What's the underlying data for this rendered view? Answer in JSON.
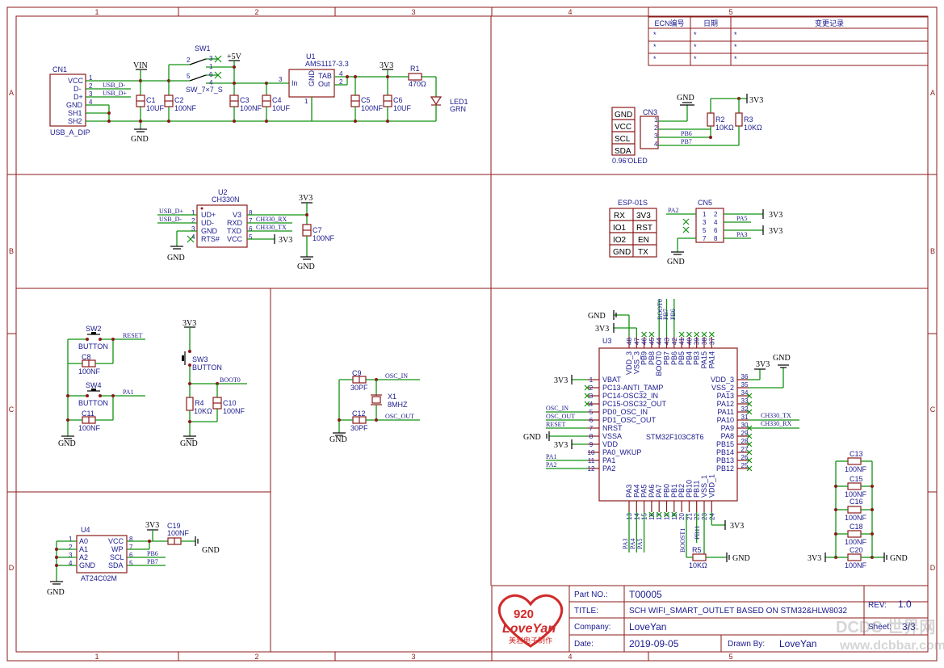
{
  "frame": {
    "columns": [
      "1",
      "2",
      "3",
      "4",
      "5"
    ],
    "rows": [
      "A",
      "B",
      "C",
      "D"
    ]
  },
  "ecn": {
    "headers": [
      "ECN编号",
      "日期",
      "变更记录"
    ],
    "rows": [
      [
        "*",
        "*",
        "*"
      ],
      [
        "*",
        "*",
        "*"
      ],
      [
        "*",
        "*",
        "*"
      ]
    ]
  },
  "usb": {
    "ref": "CN1",
    "name": "USB_A_DIP",
    "pins": [
      "VCC",
      "D-",
      "D+",
      "GND",
      "SH1",
      "SH2"
    ],
    "pin_nums": [
      "1",
      "2",
      "3",
      "4"
    ],
    "nets": [
      "USB_D-",
      "USB_D+"
    ]
  },
  "power": {
    "vin": "VIN",
    "v5": "+5V",
    "v3": "3V3",
    "gnd": "GND",
    "sw1_ref": "SW1",
    "sw1_name": "SW_7×7_S",
    "sw1_pins": [
      "2",
      "3",
      "1",
      "5",
      "6",
      "4"
    ],
    "u1_ref": "U1",
    "u1_name": "AMS1117-3.3",
    "u1_pins": [
      "In",
      "GND",
      "TAB",
      "Out"
    ],
    "u1_pin_nums": [
      "3",
      "1",
      "4",
      "2"
    ],
    "caps": [
      {
        "ref": "C1",
        "val": "10UF"
      },
      {
        "ref": "C2",
        "val": "100NF"
      },
      {
        "ref": "C3",
        "val": "100NF"
      },
      {
        "ref": "C4",
        "val": "10UF"
      },
      {
        "ref": "C5",
        "val": "100NF"
      },
      {
        "ref": "C6",
        "val": "10UF"
      }
    ],
    "r1_ref": "R1",
    "r1_val": "470Ω",
    "led_ref": "LED1",
    "led_val": "GRN"
  },
  "oled": {
    "labels": [
      "GND",
      "VCC",
      "SCL",
      "SDA"
    ],
    "name": "0.96'OLED",
    "cn_ref": "CN3",
    "pins": [
      "1",
      "2",
      "3",
      "4"
    ],
    "nets": [
      "PB6",
      "PB7"
    ],
    "r2_ref": "R2",
    "r2_val": "10KΩ",
    "r3_ref": "R3",
    "r3_val": "10KΩ"
  },
  "ch330": {
    "ref": "U2",
    "name": "CH330N",
    "left_pins": [
      "UD+",
      "UD-",
      "GND",
      "RTS#"
    ],
    "left_nums": [
      "1",
      "2",
      "3",
      "4"
    ],
    "right_pins": [
      "V3",
      "RXD",
      "TXD",
      "VCC"
    ],
    "right_nums": [
      "8",
      "7",
      "6",
      "5"
    ],
    "nets": [
      "USB_D+",
      "USB_D-",
      "CH330_RX",
      "CH330_TX"
    ],
    "c7_ref": "C7",
    "c7_val": "100NF"
  },
  "esp": {
    "title": "ESP-01S",
    "cells": [
      [
        "RX",
        "3V3"
      ],
      [
        "IO1",
        "RST"
      ],
      [
        "IO2",
        "EN"
      ],
      [
        "GND",
        "TX"
      ]
    ],
    "cn_ref": "CN5",
    "pins": [
      "1",
      "2",
      "3",
      "4",
      "5",
      "6",
      "7",
      "8"
    ],
    "nets": [
      "PA2",
      "PA5",
      "PA3"
    ]
  },
  "buttons": {
    "sw2_ref": "SW2",
    "sw2_name": "BUTTON",
    "sw4_ref": "SW4",
    "sw4_name": "BUTTON",
    "c8_ref": "C8",
    "c8_val": "100NF",
    "c11_ref": "C11",
    "c11_val": "100NF",
    "nets": [
      "RESET",
      "PA1"
    ],
    "sw3_ref": "SW3",
    "sw3_name": "BUTTON",
    "r4_ref": "R4",
    "r4_val": "10KΩ",
    "c10_ref": "C10",
    "c10_val": "100NF",
    "boot": "BOOT0"
  },
  "osc": {
    "c9_ref": "C9",
    "c9_val": "30PF",
    "c12_ref": "C12",
    "c12_val": "30PF",
    "x1_ref": "X1",
    "x1_val": "8MHZ",
    "nets": [
      "OSC_IN",
      "OSC_OUT"
    ]
  },
  "eeprom": {
    "ref": "U4",
    "name": "AT24C02M",
    "left_pins": [
      "A0",
      "A1",
      "A2",
      "GND"
    ],
    "left_nums": [
      "1",
      "2",
      "3",
      "4"
    ],
    "right_pins": [
      "VCC",
      "WP",
      "SCL",
      "SDA"
    ],
    "right_nums": [
      "8",
      "7",
      "6",
      "5"
    ],
    "nets": [
      "PB6",
      "PB7"
    ],
    "c19_ref": "C19",
    "c19_val": "100NF"
  },
  "mcu": {
    "ref": "U3",
    "name": "STM32F103C8T6",
    "left_pins": [
      "VBAT",
      "PC13-ANTI_TAMP",
      "PC14-OSC32_IN",
      "PC15-OSC32_OUT",
      "PD0_OSC_IN",
      "PD1_OSC_OUT",
      "NRST",
      "VSSA",
      "VDD",
      "PA0_WKUP",
      "PA1",
      "PA2"
    ],
    "left_nums": [
      "1",
      "2",
      "3",
      "4",
      "5",
      "6",
      "7",
      "8",
      "9",
      "10",
      "11",
      "12"
    ],
    "left_nets": [
      "OSC_IN",
      "OSC_OUT",
      "RESET",
      "PA1",
      "PA2"
    ],
    "right_pins": [
      "VDD_3",
      "VSS_2",
      "PA13",
      "PA12",
      "PA11",
      "PA10",
      "PA9",
      "PA8",
      "PB15",
      "PB14",
      "PB13",
      "PB12"
    ],
    "right_nums": [
      "36",
      "35",
      "34",
      "33",
      "32",
      "31",
      "30",
      "29",
      "28",
      "27",
      "26",
      "25"
    ],
    "right_nets": [
      "CH330_TX",
      "CH330_RX"
    ],
    "top_pins": [
      "VDD_3",
      "VSS_3",
      "PB9",
      "PB8",
      "BOOT0",
      "PB7",
      "PB6",
      "PB5",
      "PB4",
      "PB3",
      "PA15",
      "PA14"
    ],
    "top_nums": [
      "48",
      "47",
      "46",
      "45",
      "44",
      "43",
      "42",
      "41",
      "40",
      "39",
      "38",
      "37"
    ],
    "top_nets": [
      "BOOT0",
      "PB7",
      "PB6"
    ],
    "bottom_pins": [
      "PA3",
      "PA4",
      "PA5",
      "PA6",
      "PA7",
      "PB0",
      "PB1",
      "PB2",
      "PB10",
      "PB11",
      "VSS_1",
      "VDD_1"
    ],
    "bottom_nums": [
      "13",
      "14",
      "15",
      "16",
      "17",
      "18",
      "19",
      "20",
      "21",
      "22",
      "23",
      "24"
    ],
    "bottom_nets": [
      "PA3",
      "PA4",
      "PA5",
      "BOOST1",
      "PB11"
    ],
    "r5_ref": "R5",
    "r5_val": "10KΩ"
  },
  "decoupling": [
    {
      "ref": "C13",
      "val": "100NF"
    },
    {
      "ref": "C15",
      "val": "100NF"
    },
    {
      "ref": "C16",
      "val": "100NF"
    },
    {
      "ref": "C18",
      "val": "100NF"
    },
    {
      "ref": "C20",
      "val": "100NF"
    }
  ],
  "titleblock": {
    "logo_num": "920",
    "logo_name": "LoveYan",
    "logo_sub": "美岩电子制作",
    "part_label": "Part NO.:",
    "part_value": "T00005",
    "rev_label": "REV:",
    "rev_value": "1.0",
    "title_label": "TITLE:",
    "title_value": "SCH WIFI_SMART_OUTLET BASED ON STM32&HLW8032",
    "company_label": "Company:",
    "company_value": "LoveYan",
    "sheet_label": "Sheet:",
    "sheet_value": "3/3",
    "date_label": "Date:",
    "date_value": "2019-09-05",
    "drawn_label": "Drawn By:",
    "drawn_value": "LoveYan"
  },
  "watermark": {
    "name": "DCDC 世界网",
    "url": "www.dcbbar.com"
  }
}
